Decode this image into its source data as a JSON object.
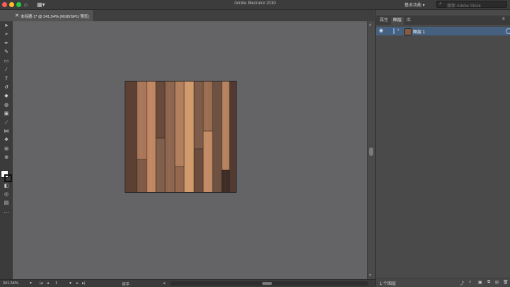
{
  "app": {
    "title": "Adobe Illustrator 2019"
  },
  "workspace": {
    "label": "基本功能 ▾"
  },
  "search": {
    "placeholder": "搜索 Adobe Stock"
  },
  "document_tab": {
    "close_glyph": "✕",
    "name": "未标题-1* @ 341.54% (RGB/GPU 预览)"
  },
  "status": {
    "zoom": "341.54%",
    "artboard_index": "1",
    "tool_name": "抓手"
  },
  "panel": {
    "tabs": [
      "属性",
      "图层",
      "库"
    ],
    "active_tab_index": 1,
    "layers": [
      {
        "name": "图层 1"
      }
    ],
    "footer_label": "1 个图层"
  },
  "toolbar": {
    "tools": [
      "selection-icon",
      "direct-selection-icon",
      "pen-icon",
      "curvature-icon",
      "rectangle-icon",
      "paintbrush-icon",
      "type-icon",
      "rotate-icon",
      "eraser-icon",
      "shape-builder-icon",
      "gradient-icon",
      "eyedropper-icon",
      "blend-icon",
      "symbol-sprayer-icon",
      "artboard-icon",
      "zoom-icon"
    ]
  },
  "colors": {
    "accent": "#46607f",
    "close_red": "#ff5f56",
    "minimize_yellow": "#ffbd2e",
    "maximize_green": "#27c93f"
  }
}
